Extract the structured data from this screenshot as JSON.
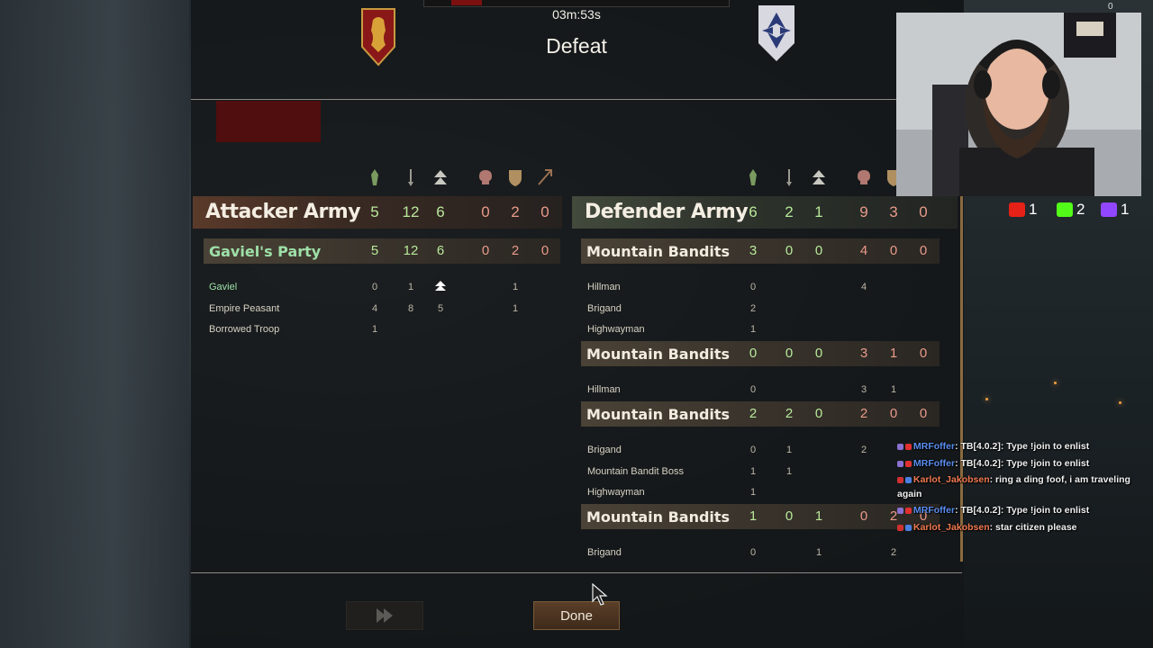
{
  "header": {
    "timer": "03m:53s",
    "result": "Defeat"
  },
  "attacker": {
    "name": "Attacker Army",
    "stats": [
      "5",
      "12",
      "6",
      "0",
      "2",
      "0"
    ],
    "parties": [
      {
        "name": "Gaviel's Party",
        "stats": [
          "5",
          "12",
          "6",
          "0",
          "2",
          "0"
        ],
        "troops": [
          {
            "name": "Gaviel",
            "c1": "0",
            "c2": "1",
            "c3": "",
            "c4": "",
            "c5": "1",
            "c6": ""
          },
          {
            "name": "Empire Peasant",
            "c1": "4",
            "c2": "8",
            "c3": "5",
            "c4": "",
            "c5": "1",
            "c6": ""
          },
          {
            "name": "Borrowed Troop",
            "c1": "1",
            "c2": "",
            "c3": "",
            "c4": "",
            "c5": "",
            "c6": ""
          }
        ]
      }
    ]
  },
  "defender": {
    "name": "Defender Army",
    "stats": [
      "6",
      "2",
      "1",
      "9",
      "3",
      "0"
    ],
    "parties": [
      {
        "name": "Mountain Bandits",
        "stats": [
          "3",
          "0",
          "0",
          "4",
          "0",
          "0"
        ],
        "troops": [
          {
            "name": "Hillman",
            "c1": "0",
            "c2": "",
            "c3": "",
            "c4": "4",
            "c5": "",
            "c6": ""
          },
          {
            "name": "Brigand",
            "c1": "2",
            "c2": "",
            "c3": "",
            "c4": "",
            "c5": "",
            "c6": ""
          },
          {
            "name": "Highwayman",
            "c1": "1",
            "c2": "",
            "c3": "",
            "c4": "",
            "c5": "",
            "c6": ""
          }
        ]
      },
      {
        "name": "Mountain Bandits",
        "stats": [
          "0",
          "0",
          "0",
          "3",
          "1",
          "0"
        ],
        "troops": [
          {
            "name": "Hillman",
            "c1": "0",
            "c2": "",
            "c3": "",
            "c4": "3",
            "c5": "1",
            "c6": ""
          }
        ]
      },
      {
        "name": "Mountain Bandits",
        "stats": [
          "2",
          "2",
          "0",
          "2",
          "0",
          "0"
        ],
        "troops": [
          {
            "name": "Brigand",
            "c1": "0",
            "c2": "1",
            "c3": "",
            "c4": "2",
            "c5": "",
            "c6": ""
          },
          {
            "name": "Mountain Bandit Boss",
            "c1": "1",
            "c2": "1",
            "c3": "",
            "c4": "",
            "c5": "",
            "c6": ""
          },
          {
            "name": "Highwayman",
            "c1": "1",
            "c2": "",
            "c3": "",
            "c4": "",
            "c5": "",
            "c6": ""
          }
        ]
      },
      {
        "name": "Mountain Bandits",
        "stats": [
          "1",
          "0",
          "1",
          "0",
          "2",
          "0"
        ],
        "troops": [
          {
            "name": "Brigand",
            "c1": "0",
            "c2": "",
            "c3": "1",
            "c4": "",
            "c5": "2",
            "c6": ""
          }
        ]
      }
    ]
  },
  "buttons": {
    "done": "Done"
  },
  "stream": {
    "social": [
      {
        "platform": "youtube",
        "count": "1",
        "color": "#e62117"
      },
      {
        "platform": "kick",
        "count": "2",
        "color": "#53fc18"
      },
      {
        "platform": "twitch",
        "count": "1",
        "color": "#9146ff"
      }
    ],
    "corner_count": "0",
    "chat": [
      {
        "user": "MRFoffer",
        "text": ": TB[4.0.2]: Type !join to enlist",
        "color": "blue"
      },
      {
        "user": "MRFoffer",
        "text": ": TB[4.0.2]: Type !join to enlist",
        "color": "blue"
      },
      {
        "user": "Karlot_Jakobsen",
        "text": ": ring a ding foof, i am traveling again",
        "color": "red"
      },
      {
        "user": "MRFoffer",
        "text": ": TB[4.0.2]: Type !join to enlist",
        "color": "blue"
      },
      {
        "user": "Karlot_Jakobsen",
        "text": ": star citizen please",
        "color": "red"
      }
    ]
  },
  "colors": {
    "kills_green": "#b8e89a",
    "deaths_red": "#e89a8a",
    "player_party": "#9ee0a8",
    "panel_bg": "#121416"
  }
}
